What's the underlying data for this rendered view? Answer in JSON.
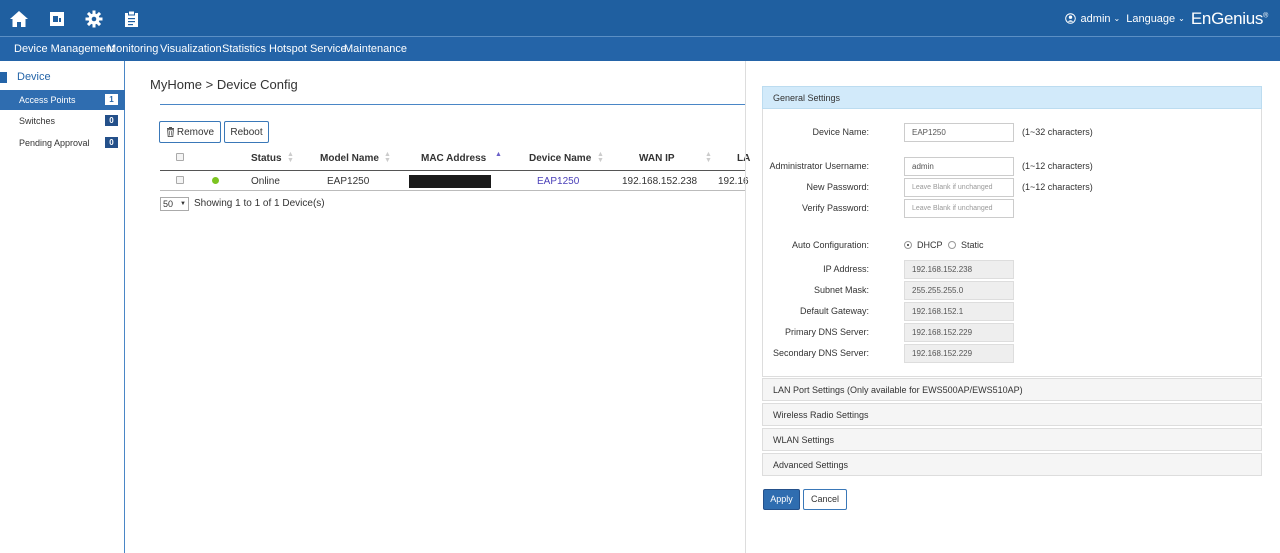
{
  "topbar": {
    "icons": [
      "home-icon",
      "dashboard-icon",
      "gear-icon",
      "clipboard-icon"
    ],
    "user": "admin",
    "language": "Language",
    "brand": "EnGenius"
  },
  "nav": [
    "Device Management",
    "Monitoring",
    "Visualization",
    "Statistics",
    "Hotspot Service",
    "Maintenance"
  ],
  "sidebar": {
    "header": "Device",
    "items": [
      {
        "label": "Access Points",
        "count": "1"
      },
      {
        "label": "Switches",
        "count": "0"
      },
      {
        "label": "Pending Approval",
        "count": "0"
      }
    ]
  },
  "main": {
    "breadcrumb": "MyHome > Device Config",
    "buttons": {
      "remove": "Remove",
      "reboot": "Reboot"
    },
    "columns": [
      "Status",
      "Model Name",
      "MAC Address",
      "Device Name",
      "WAN IP",
      "LA"
    ],
    "row": {
      "status": "Online",
      "model": "EAP1250",
      "device_name": "EAP1250",
      "wan_ip": "192.168.152.238",
      "lan_ip": "192.16"
    },
    "page_size": "50",
    "showing": "Showing 1 to 1 of 1 Device(s)"
  },
  "general": {
    "title": "General Settings",
    "device_name_label": "Device Name:",
    "device_name_value": "EAP1250",
    "device_name_hint": "(1~32 characters)",
    "admin_user_label": "Administrator Username:",
    "admin_user_value": "admin",
    "admin_user_hint": "(1~12 characters)",
    "new_pw_label": "New Password:",
    "new_pw_placeholder": "Leave Blank if unchanged",
    "new_pw_hint": "(1~12 characters)",
    "verify_pw_label": "Verify Password:",
    "verify_pw_placeholder": "Leave Blank if unchanged",
    "auto_config_label": "Auto Configuration:",
    "dhcp": "DHCP",
    "static": "Static",
    "ip_label": "IP Address:",
    "ip_value": "192.168.152.238",
    "mask_label": "Subnet Mask:",
    "mask_value": "255.255.255.0",
    "gw_label": "Default Gateway:",
    "gw_value": "192.168.152.1",
    "dns1_label": "Primary DNS Server:",
    "dns1_value": "192.168.152.229",
    "dns2_label": "Secondary DNS Server:",
    "dns2_value": "192.168.152.229"
  },
  "sections": [
    "LAN Port Settings (Only available for EWS500AP/EWS510AP)",
    "Wireless Radio Settings",
    "WLAN Settings",
    "Advanced Settings"
  ],
  "actions": {
    "apply": "Apply",
    "cancel": "Cancel"
  },
  "colors": {
    "primary": "#1f5fa0",
    "accent": "#2f6db0",
    "online": "#7cc420",
    "link": "#4a3fb8"
  }
}
